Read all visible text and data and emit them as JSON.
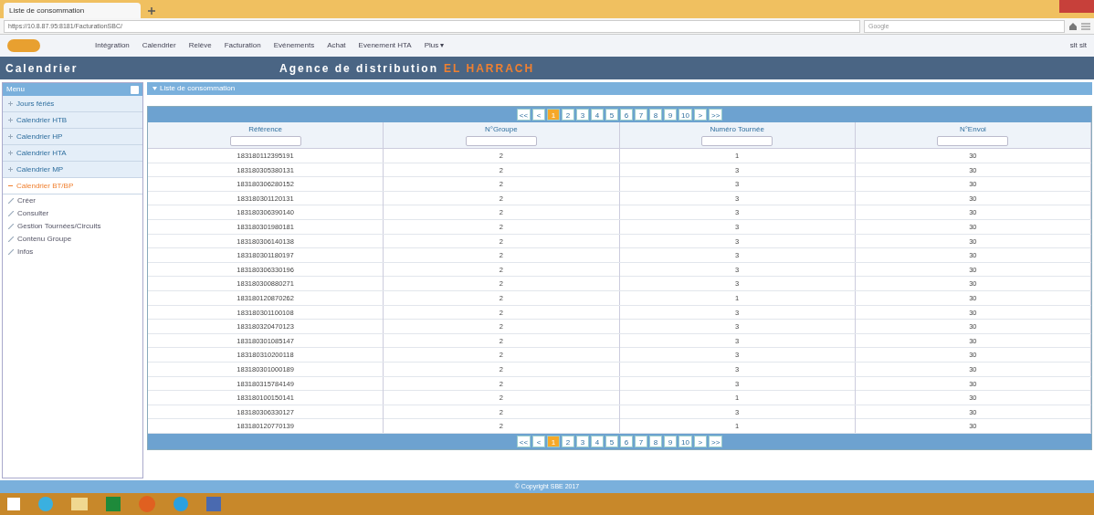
{
  "browser": {
    "tab": "Liste de consommation",
    "url": "https://10.8.87.95:8181/FacturationSBC/",
    "search_placeholder": "Google"
  },
  "nav": {
    "items": [
      "Intégration",
      "Calendrier",
      "Relève",
      "Facturation",
      "Evénements",
      "Achat",
      "Evenement HTA",
      "Plus ▾"
    ],
    "user": "slt slt"
  },
  "header": {
    "title": "Calendrier",
    "agency": "Agence de distribution",
    "agency_name": "EL HARRACH"
  },
  "sidebar": {
    "title": "Menu",
    "items": [
      {
        "label": "Jours fériés",
        "expanded": false
      },
      {
        "label": "Calendrier HTB",
        "expanded": false
      },
      {
        "label": "Calendrier HP",
        "expanded": false
      },
      {
        "label": "Calendrier HTA",
        "expanded": false
      },
      {
        "label": "Calendrier MP",
        "expanded": false
      },
      {
        "label": "Calendrier BT/BP",
        "expanded": true,
        "children": [
          {
            "label": "Créer"
          },
          {
            "label": "Consulter"
          },
          {
            "label": "Gestion Tournées/Circuits"
          },
          {
            "label": "Contenu Groupe"
          },
          {
            "label": "Infos"
          }
        ]
      }
    ]
  },
  "panel": {
    "title": "Liste de consommation"
  },
  "pager_top": [
    {
      "label": "<<",
      "selected": false
    },
    {
      "label": "<",
      "selected": false
    },
    {
      "label": "1",
      "selected": true
    },
    {
      "label": "2",
      "selected": false
    },
    {
      "label": "3",
      "selected": false
    },
    {
      "label": "4",
      "selected": false
    },
    {
      "label": "5",
      "selected": false
    },
    {
      "label": "6",
      "selected": false
    },
    {
      "label": "7",
      "selected": false
    },
    {
      "label": "8",
      "selected": false
    },
    {
      "label": "9",
      "selected": false
    },
    {
      "label": "10",
      "selected": false
    },
    {
      "label": ">",
      "selected": false
    },
    {
      "label": ">>",
      "selected": false
    }
  ],
  "pager_bottom": [
    {
      "label": "<<",
      "selected": false
    },
    {
      "label": "<",
      "selected": false
    },
    {
      "label": "1",
      "selected": true
    },
    {
      "label": "2",
      "selected": false
    },
    {
      "label": "3",
      "selected": false
    },
    {
      "label": "4",
      "selected": false
    },
    {
      "label": "5",
      "selected": false
    },
    {
      "label": "6",
      "selected": false
    },
    {
      "label": "7",
      "selected": false
    },
    {
      "label": "8",
      "selected": false
    },
    {
      "label": "9",
      "selected": false
    },
    {
      "label": "10",
      "selected": false
    },
    {
      "label": ">",
      "selected": false
    },
    {
      "label": ">>",
      "selected": false
    }
  ],
  "table": {
    "columns": [
      "Référence",
      "N°Groupe",
      "Numéro Tournée",
      "N°Envoi"
    ],
    "rows": [
      [
        "183180112395191",
        "2",
        "1",
        "30"
      ],
      [
        "183180305380131",
        "2",
        "3",
        "30"
      ],
      [
        "183180306280152",
        "2",
        "3",
        "30"
      ],
      [
        "183180301120131",
        "2",
        "3",
        "30"
      ],
      [
        "183180306390140",
        "2",
        "3",
        "30"
      ],
      [
        "183180301980181",
        "2",
        "3",
        "30"
      ],
      [
        "183180306140138",
        "2",
        "3",
        "30"
      ],
      [
        "183180301180197",
        "2",
        "3",
        "30"
      ],
      [
        "183180306330196",
        "2",
        "3",
        "30"
      ],
      [
        "183180300880271",
        "2",
        "3",
        "30"
      ],
      [
        "183180120870262",
        "2",
        "1",
        "30"
      ],
      [
        "183180301100108",
        "2",
        "3",
        "30"
      ],
      [
        "183180320470123",
        "2",
        "3",
        "30"
      ],
      [
        "183180301085147",
        "2",
        "3",
        "30"
      ],
      [
        "183180310200118",
        "2",
        "3",
        "30"
      ],
      [
        "183180301000189",
        "2",
        "3",
        "30"
      ],
      [
        "183180315784149",
        "2",
        "3",
        "30"
      ],
      [
        "183180100150141",
        "2",
        "1",
        "30"
      ],
      [
        "183180306330127",
        "2",
        "3",
        "30"
      ],
      [
        "183180120770139",
        "2",
        "1",
        "30"
      ]
    ]
  },
  "footer": "© Copyright SBE 2017"
}
